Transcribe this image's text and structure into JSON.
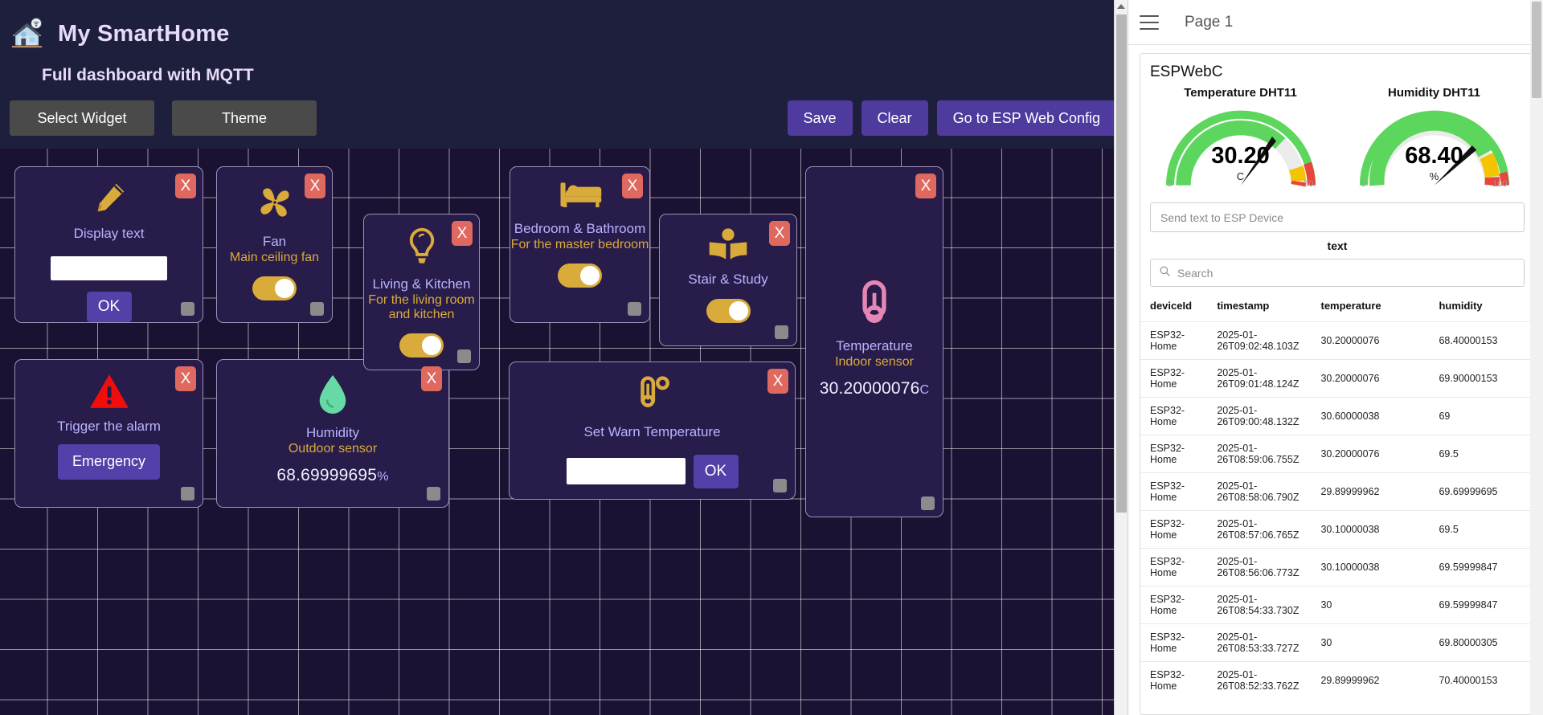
{
  "dashboard": {
    "app_title": "My SmartHome",
    "subtitle": "Full dashboard with MQTT",
    "home_icon": "smart-home-icon",
    "buttons": {
      "select_widget": "Select Widget",
      "theme": "Theme",
      "save": "Save",
      "clear": "Clear",
      "esp_config": "Go to ESP Web Config"
    },
    "close_label": "X",
    "widgets": [
      {
        "id": "display-text",
        "icon": "pencil-icon",
        "name": "Display text",
        "desc": "",
        "value": "",
        "input_value": "",
        "ok_label": "OK"
      },
      {
        "id": "fan",
        "icon": "fan-icon",
        "name": "Fan",
        "desc": "Main ceiling fan",
        "toggle_on": true
      },
      {
        "id": "living-kitchen",
        "icon": "lightbulb-icon",
        "name": "Living & Kitchen",
        "desc": "For the living room and kitchen",
        "toggle_on": true
      },
      {
        "id": "bedroom-bathroom",
        "icon": "bed-icon",
        "name": "Bedroom & Bathroom",
        "desc": "For the master bedroom",
        "toggle_on": true
      },
      {
        "id": "stair-study",
        "icon": "book-reader-icon",
        "name": "Stair & Study",
        "desc": "",
        "toggle_on": true
      },
      {
        "id": "temperature-indoor",
        "icon": "thermometer-icon",
        "name": "Temperature",
        "desc": "Indoor sensor",
        "value": "30.20000076",
        "unit": "C"
      },
      {
        "id": "alarm",
        "icon": "warning-triangle-icon",
        "name": "Trigger the alarm",
        "desc": "",
        "button_label": "Emergency"
      },
      {
        "id": "humidity-outdoor",
        "icon": "water-drop-icon",
        "name": "Humidity",
        "desc": "Outdoor sensor",
        "value": "68.69999695",
        "unit": "%"
      },
      {
        "id": "set-warn-temperature",
        "icon": "thermometer-dot-icon",
        "name": "Set Warn Temperature",
        "desc": "",
        "input_value": "",
        "ok_label": "OK"
      }
    ]
  },
  "right_panel": {
    "menu_icon": "hamburger-menu-icon",
    "page_label": "Page 1",
    "card_title": "ESPWebC",
    "gauges": [
      {
        "title": "Temperature DHT11",
        "value": "30.20",
        "unit": "C",
        "min": "0",
        "max": "50",
        "numeric_value": 30.2,
        "range_min": 0,
        "range_max": 50,
        "band_green_end": 80,
        "band_yellow_end": 90,
        "band_red_end": 100,
        "colors": {
          "green": "#5cd65c",
          "yellow": "#f5c400",
          "red": "#e8453c",
          "track": "#ebebeb"
        }
      },
      {
        "title": "Humidity DHT11",
        "value": "68.40",
        "unit": "%",
        "min": "0",
        "max": "100",
        "numeric_value": 68.4,
        "range_min": 0,
        "range_max": 100,
        "band_green_end": 75,
        "band_yellow_end": 87,
        "band_red_end": 100,
        "colors": {
          "green": "#5cd65c",
          "yellow": "#f5c400",
          "red": "#e8453c",
          "track": "#ebebeb"
        }
      }
    ],
    "send_input": {
      "placeholder": "Send text to ESP Device",
      "value": ""
    },
    "text_label": "text",
    "search": {
      "placeholder": "Search",
      "value": "",
      "icon": "search-icon"
    },
    "table": {
      "columns": [
        "deviceId",
        "timestamp",
        "temperature",
        "humidity"
      ],
      "rows": [
        [
          "ESP32-Home",
          "2025-01-26T09:02:48.103Z",
          "30.20000076",
          "68.40000153"
        ],
        [
          "ESP32-Home",
          "2025-01-26T09:01:48.124Z",
          "30.20000076",
          "69.90000153"
        ],
        [
          "ESP32-Home",
          "2025-01-26T09:00:48.132Z",
          "30.60000038",
          "69"
        ],
        [
          "ESP32-Home",
          "2025-01-26T08:59:06.755Z",
          "30.20000076",
          "69.5"
        ],
        [
          "ESP32-Home",
          "2025-01-26T08:58:06.790Z",
          "29.89999962",
          "69.69999695"
        ],
        [
          "ESP32-Home",
          "2025-01-26T08:57:06.765Z",
          "30.10000038",
          "69.5"
        ],
        [
          "ESP32-Home",
          "2025-01-26T08:56:06.773Z",
          "30.10000038",
          "69.59999847"
        ],
        [
          "ESP32-Home",
          "2025-01-26T08:54:33.730Z",
          "30",
          "69.59999847"
        ],
        [
          "ESP32-Home",
          "2025-01-26T08:53:33.727Z",
          "30",
          "69.80000305"
        ],
        [
          "ESP32-Home",
          "2025-01-26T08:52:33.762Z",
          "29.89999962",
          "70.40000153"
        ]
      ]
    }
  },
  "colors": {
    "dash_bg": "#1e1f3d",
    "grid_bg": "#1b1233",
    "card_bg": "#281c4a",
    "accent_purple": "#4f3b9e",
    "accent_gold": "#d9ab3b",
    "accent_red": "#e0695f",
    "text_lavender": "#b9b4ff"
  }
}
